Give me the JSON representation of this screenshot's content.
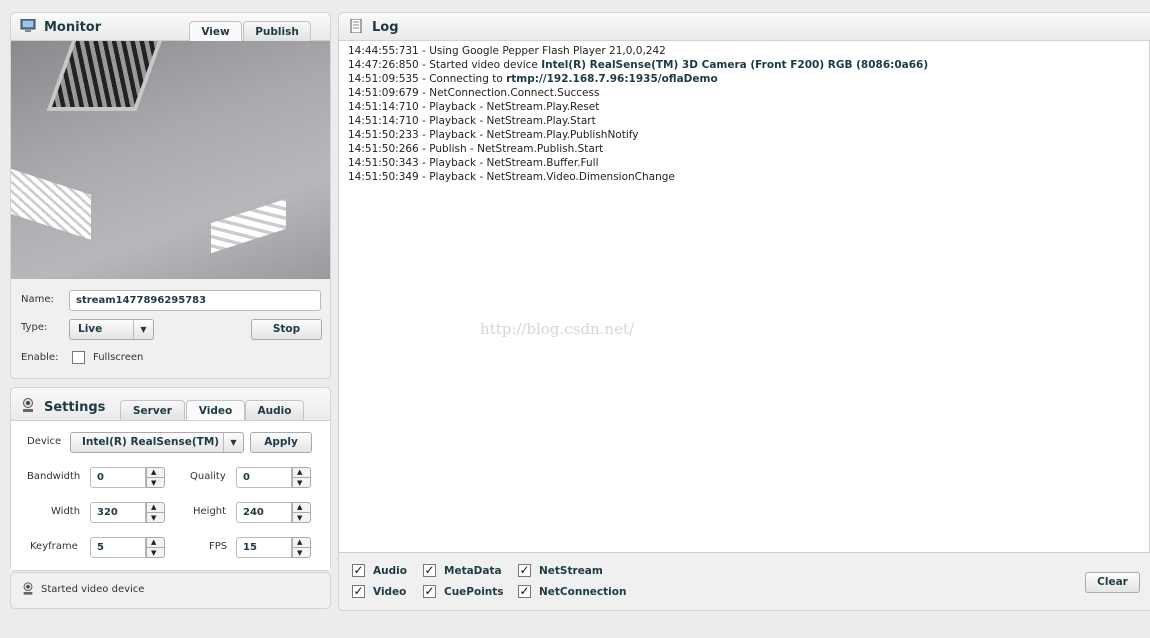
{
  "monitor": {
    "title": "Monitor",
    "icon": "monitor-icon",
    "tabs": [
      {
        "label": "View"
      },
      {
        "label": "Publish"
      }
    ],
    "name_label": "Name:",
    "name_value": "stream1477896295783",
    "type_label": "Type:",
    "type_value": "Live",
    "stop_label": "Stop",
    "enable_label": "Enable:",
    "fullscreen_label": "Fullscreen",
    "fullscreen_checked": false
  },
  "settings": {
    "title": "Settings",
    "icon": "webcam-icon",
    "tabs": [
      {
        "label": "Server"
      },
      {
        "label": "Video"
      },
      {
        "label": "Audio"
      }
    ],
    "device_label": "Device",
    "device_value": "Intel(R) RealSense(TM)",
    "apply_label": "Apply",
    "fields": {
      "bandwidth": {
        "label": "Bandwidth",
        "value": "0"
      },
      "quality": {
        "label": "Quality",
        "value": "0"
      },
      "width": {
        "label": "Width",
        "value": "320"
      },
      "height": {
        "label": "Height",
        "value": "240"
      },
      "keyframe": {
        "label": "Keyframe",
        "value": "5"
      },
      "fps": {
        "label": "FPS",
        "value": "15"
      }
    }
  },
  "status": {
    "text": "Started video device"
  },
  "log": {
    "title": "Log",
    "icon": "notebook-icon",
    "entries": [
      {
        "time": "14:44:55:731",
        "text": "Using Google Pepper Flash Player 21,0,0,242",
        "bold": ""
      },
      {
        "time": "14:47:26:850",
        "text": "Started video device ",
        "bold": "Intel(R) RealSense(TM) 3D Camera (Front F200) RGB (8086:0a66)"
      },
      {
        "time": "14:51:09:535",
        "text": "Connecting to ",
        "bold": "rtmp://192.168.7.96:1935/oflaDemo"
      },
      {
        "time": "14:51:09:679",
        "text": "NetConnection.Connect.Success",
        "bold": ""
      },
      {
        "time": "14:51:14:710",
        "text": "Playback - NetStream.Play.Reset",
        "bold": ""
      },
      {
        "time": "14:51:14:710",
        "text": "Playback - NetStream.Play.Start",
        "bold": ""
      },
      {
        "time": "14:51:50:233",
        "text": "Playback - NetStream.Play.PublishNotify",
        "bold": ""
      },
      {
        "time": "14:51:50:266",
        "text": "Publish - NetStream.Publish.Start",
        "bold": ""
      },
      {
        "time": "14:51:50:343",
        "text": "Playback - NetStream.Buffer.Full",
        "bold": ""
      },
      {
        "time": "14:51:50:349",
        "text": "Playback - NetStream.Video.DimensionChange",
        "bold": ""
      }
    ],
    "filters": [
      {
        "label": "Audio",
        "checked": true
      },
      {
        "label": "MetaData",
        "checked": true
      },
      {
        "label": "NetStream",
        "checked": true
      },
      {
        "label": "Video",
        "checked": true
      },
      {
        "label": "CuePoints",
        "checked": true
      },
      {
        "label": "NetConnection",
        "checked": true
      }
    ],
    "clear_label": "Clear"
  },
  "watermark": "http://blog.csdn.net/"
}
